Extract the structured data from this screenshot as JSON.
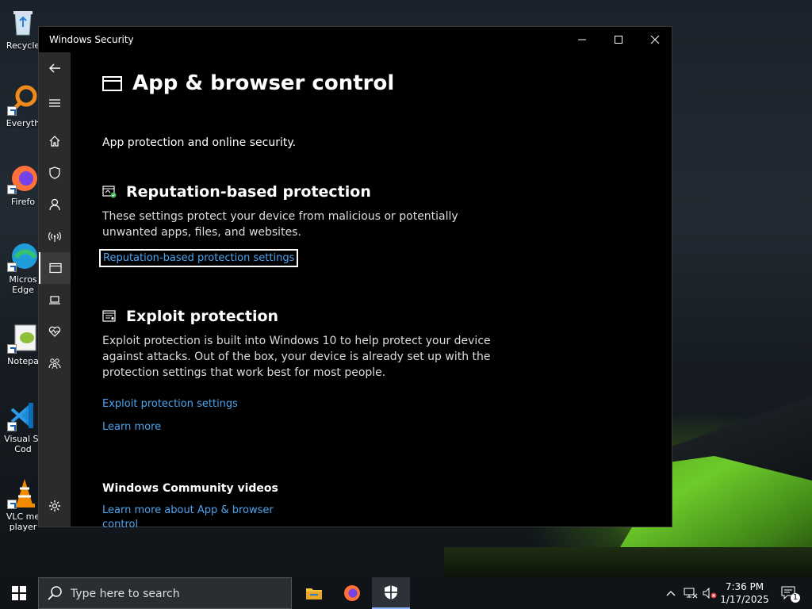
{
  "desktop": {
    "icons": [
      {
        "label": "Recycle"
      },
      {
        "label": "Everyth"
      },
      {
        "label": "Firefo"
      },
      {
        "label": "Micros Edge"
      },
      {
        "label": "Notepa"
      },
      {
        "label": "Visual St Cod"
      },
      {
        "label": "VLC me player"
      }
    ]
  },
  "window": {
    "title": "Windows Security",
    "controls": {
      "minimize": "—",
      "maximize": "☐",
      "close": "✕"
    }
  },
  "sidebar": {
    "items": [
      {
        "icon": "back-arrow-icon"
      },
      {
        "icon": "hamburger-menu-icon"
      },
      {
        "icon": "home-icon"
      },
      {
        "icon": "shield-icon"
      },
      {
        "icon": "person-icon"
      },
      {
        "icon": "wireless-antenna-icon"
      },
      {
        "icon": "app-browser-window-icon"
      },
      {
        "icon": "laptop-icon"
      },
      {
        "icon": "heart-health-icon"
      },
      {
        "icon": "family-icon"
      },
      {
        "icon": "settings-gear-icon"
      }
    ]
  },
  "page": {
    "title": "App & browser control",
    "subtitle": "App protection and online security.",
    "reputation": {
      "title": "Reputation-based protection",
      "description": "These settings protect your device from malicious or potentially unwanted apps, files, and websites.",
      "link": "Reputation-based protection settings"
    },
    "exploit": {
      "title": "Exploit protection",
      "description": "Exploit protection is built into Windows 10 to help protect your device against attacks.  Out of the box, your device is already set up with the protection settings that work best for most people.",
      "link_settings": "Exploit protection settings",
      "link_learn": "Learn more"
    },
    "community": {
      "title": "Windows Community videos",
      "link_line1": "Learn more about App & browser",
      "link_line2": "control"
    }
  },
  "taskbar": {
    "search_placeholder": "Type here to search",
    "time": "7:36 PM",
    "date": "1/17/2025",
    "notification_count": "1"
  },
  "colors": {
    "link": "#4ea3f0",
    "sidebar": "#2b2b2b",
    "window_bg": "#000000"
  }
}
